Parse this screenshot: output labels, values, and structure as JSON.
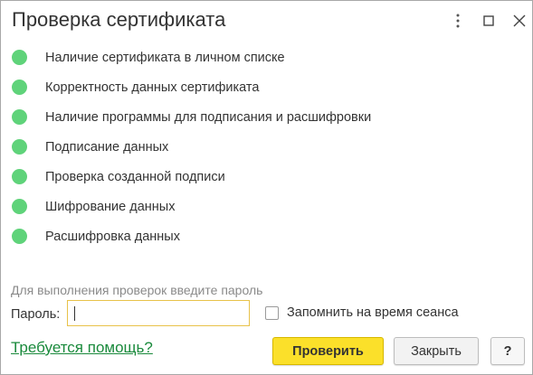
{
  "window": {
    "title": "Проверка сертификата",
    "controls": [
      "more-icon",
      "maximize-icon",
      "close-icon"
    ]
  },
  "checks": [
    {
      "label": "Наличие сертификата в личном списке",
      "status": "ok"
    },
    {
      "label": "Корректность данных сертификата",
      "status": "ok"
    },
    {
      "label": "Наличие программы для подписания и расшифровки",
      "status": "ok"
    },
    {
      "label": "Подписание данных",
      "status": "ok"
    },
    {
      "label": "Проверка созданной подписи",
      "status": "ok"
    },
    {
      "label": "Шифрование данных",
      "status": "ok"
    },
    {
      "label": "Расшифровка данных",
      "status": "ok"
    }
  ],
  "status_color": "#5fd37a",
  "password": {
    "hint": "Для выполнения проверок введите пароль",
    "label": "Пароль:",
    "value": "",
    "remember_label": "Запомнить на время сеанса",
    "remember_checked": false
  },
  "footer": {
    "help_link": "Требуется помощь?",
    "check_button": "Проверить",
    "close_button": "Закрыть",
    "help_button": "?"
  },
  "colors": {
    "accent_button": "#fbe02a",
    "link": "#1a8a3c",
    "input_focus_border": "#e8c24a"
  }
}
